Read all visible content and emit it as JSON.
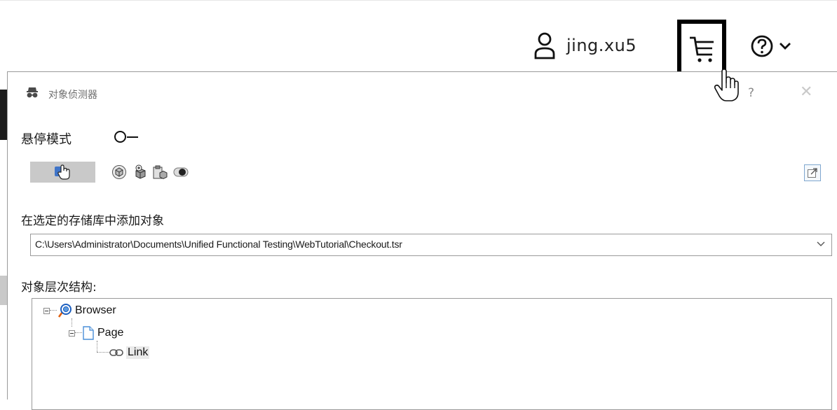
{
  "header": {
    "username": "jing.xu5",
    "icons": {
      "user": "user-icon",
      "cart": "cart-icon",
      "help": "help-icon",
      "chevron": "chevron-down-icon"
    }
  },
  "spy": {
    "title": "对象侦测器",
    "help": "?",
    "close": "✕",
    "hover_mode_label": "悬停模式",
    "hover_mode_on": false,
    "add_to_repo_label": "在选定的存储库中添加对象",
    "repository_path": "C:\\Users\\Administrator\\Documents\\Unified Functional Testing\\WebTutorial\\Checkout.tsr",
    "hierarchy_label": "对象层次结构:",
    "tree": [
      {
        "label": "Browser",
        "icon": "browser-icon",
        "level": 0
      },
      {
        "label": "Page",
        "icon": "page-icon",
        "level": 1
      },
      {
        "label": "Link",
        "icon": "link-icon",
        "level": 2,
        "selected": true
      }
    ]
  },
  "colors": {
    "toolbar_active": "#c9c9c9",
    "border": "#9a9a9a"
  }
}
